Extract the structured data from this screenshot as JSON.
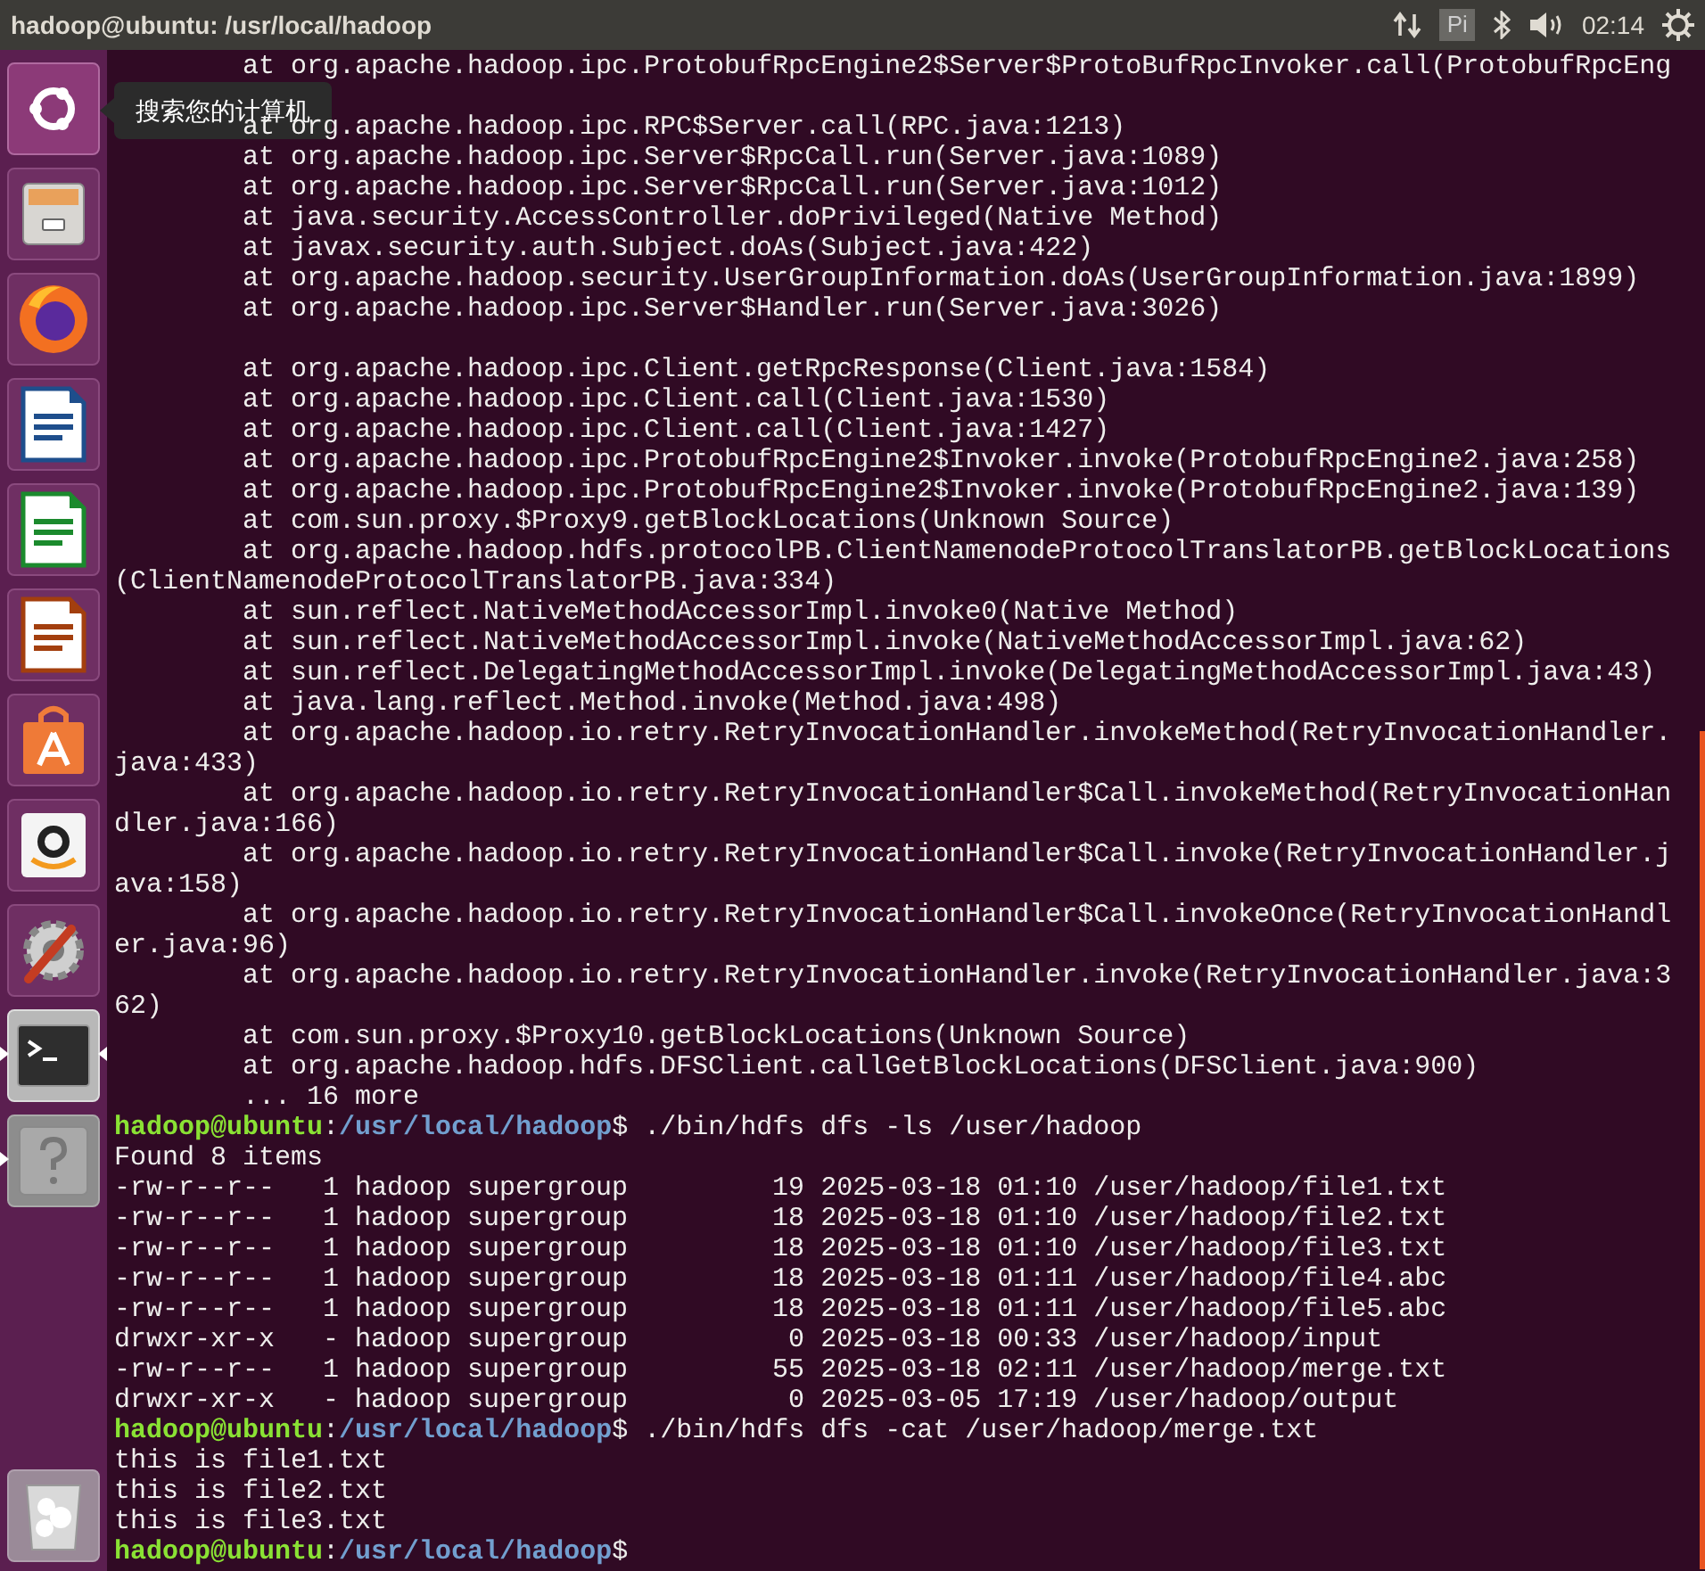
{
  "top_bar": {
    "title": "hadoop@ubuntu: /usr/local/hadoop",
    "input_method": "Pi",
    "clock": "02:14"
  },
  "launcher": {
    "items": [
      {
        "kind": "dash",
        "running": false,
        "focused": false
      },
      {
        "kind": "files",
        "running": false,
        "focused": false
      },
      {
        "kind": "browser",
        "running": false,
        "focused": false
      },
      {
        "kind": "writer",
        "running": false,
        "focused": false
      },
      {
        "kind": "calc",
        "running": false,
        "focused": false
      },
      {
        "kind": "impress",
        "running": false,
        "focused": false
      },
      {
        "kind": "store",
        "running": false,
        "focused": false
      },
      {
        "kind": "amazon",
        "running": false,
        "focused": false
      },
      {
        "kind": "settings",
        "running": false,
        "focused": false
      },
      {
        "kind": "terminal",
        "running": true,
        "focused": true
      },
      {
        "kind": "help",
        "running": true,
        "focused": false
      }
    ],
    "trash": {
      "kind": "trash"
    },
    "tooltip": "搜索您的计算机"
  },
  "terminal": {
    "lines": [
      {
        "kind": "output",
        "text": "        at org.apache.hadoop.ipc.ProtobufRpcEngine2$Server$ProtoBufRpcInvoker.call(ProtobufRpcEng"
      },
      {
        "kind": "blank"
      },
      {
        "kind": "output",
        "text": "        at org.apache.hadoop.ipc.RPC$Server.call(RPC.java:1213)"
      },
      {
        "kind": "output",
        "text": "        at org.apache.hadoop.ipc.Server$RpcCall.run(Server.java:1089)"
      },
      {
        "kind": "output",
        "text": "        at org.apache.hadoop.ipc.Server$RpcCall.run(Server.java:1012)"
      },
      {
        "kind": "output",
        "text": "        at java.security.AccessController.doPrivileged(Native Method)"
      },
      {
        "kind": "output",
        "text": "        at javax.security.auth.Subject.doAs(Subject.java:422)"
      },
      {
        "kind": "output",
        "text": "        at org.apache.hadoop.security.UserGroupInformation.doAs(UserGroupInformation.java:1899)"
      },
      {
        "kind": "output",
        "text": "        at org.apache.hadoop.ipc.Server$Handler.run(Server.java:3026)"
      },
      {
        "kind": "blank"
      },
      {
        "kind": "output",
        "text": "        at org.apache.hadoop.ipc.Client.getRpcResponse(Client.java:1584)"
      },
      {
        "kind": "output",
        "text": "        at org.apache.hadoop.ipc.Client.call(Client.java:1530)"
      },
      {
        "kind": "output",
        "text": "        at org.apache.hadoop.ipc.Client.call(Client.java:1427)"
      },
      {
        "kind": "output",
        "text": "        at org.apache.hadoop.ipc.ProtobufRpcEngine2$Invoker.invoke(ProtobufRpcEngine2.java:258)"
      },
      {
        "kind": "output",
        "text": "        at org.apache.hadoop.ipc.ProtobufRpcEngine2$Invoker.invoke(ProtobufRpcEngine2.java:139)"
      },
      {
        "kind": "output",
        "text": "        at com.sun.proxy.$Proxy9.getBlockLocations(Unknown Source)"
      },
      {
        "kind": "output",
        "text": "        at org.apache.hadoop.hdfs.protocolPB.ClientNamenodeProtocolTranslatorPB.getBlockLocations"
      },
      {
        "kind": "output",
        "text": "(ClientNamenodeProtocolTranslatorPB.java:334)"
      },
      {
        "kind": "output",
        "text": "        at sun.reflect.NativeMethodAccessorImpl.invoke0(Native Method)"
      },
      {
        "kind": "output",
        "text": "        at sun.reflect.NativeMethodAccessorImpl.invoke(NativeMethodAccessorImpl.java:62)"
      },
      {
        "kind": "output",
        "text": "        at sun.reflect.DelegatingMethodAccessorImpl.invoke(DelegatingMethodAccessorImpl.java:43)"
      },
      {
        "kind": "output",
        "text": "        at java.lang.reflect.Method.invoke(Method.java:498)"
      },
      {
        "kind": "output",
        "text": "        at org.apache.hadoop.io.retry.RetryInvocationHandler.invokeMethod(RetryInvocationHandler."
      },
      {
        "kind": "output",
        "text": "java:433)"
      },
      {
        "kind": "output",
        "text": "        at org.apache.hadoop.io.retry.RetryInvocationHandler$Call.invokeMethod(RetryInvocationHan"
      },
      {
        "kind": "output",
        "text": "dler.java:166)"
      },
      {
        "kind": "output",
        "text": "        at org.apache.hadoop.io.retry.RetryInvocationHandler$Call.invoke(RetryInvocationHandler.j"
      },
      {
        "kind": "output",
        "text": "ava:158)"
      },
      {
        "kind": "output",
        "text": "        at org.apache.hadoop.io.retry.RetryInvocationHandler$Call.invokeOnce(RetryInvocationHandl"
      },
      {
        "kind": "output",
        "text": "er.java:96)"
      },
      {
        "kind": "output",
        "text": "        at org.apache.hadoop.io.retry.RetryInvocationHandler.invoke(RetryInvocationHandler.java:3"
      },
      {
        "kind": "output",
        "text": "62)"
      },
      {
        "kind": "output",
        "text": "        at com.sun.proxy.$Proxy10.getBlockLocations(Unknown Source)"
      },
      {
        "kind": "output",
        "text": "        at org.apache.hadoop.hdfs.DFSClient.callGetBlockLocations(DFSClient.java:900)"
      },
      {
        "kind": "output",
        "text": "        ... 16 more"
      },
      {
        "kind": "prompt",
        "user": "hadoop@ubuntu",
        "sep": ":",
        "path": "/usr/local/hadoop",
        "sign": "$",
        "command": " ./bin/hdfs dfs -ls /user/hadoop"
      },
      {
        "kind": "output",
        "text": "Found 8 items"
      },
      {
        "kind": "output",
        "text": "-rw-r--r--   1 hadoop supergroup         19 2025-03-18 01:10 /user/hadoop/file1.txt"
      },
      {
        "kind": "output",
        "text": "-rw-r--r--   1 hadoop supergroup         18 2025-03-18 01:10 /user/hadoop/file2.txt"
      },
      {
        "kind": "output",
        "text": "-rw-r--r--   1 hadoop supergroup         18 2025-03-18 01:10 /user/hadoop/file3.txt"
      },
      {
        "kind": "output",
        "text": "-rw-r--r--   1 hadoop supergroup         18 2025-03-18 01:11 /user/hadoop/file4.abc"
      },
      {
        "kind": "output",
        "text": "-rw-r--r--   1 hadoop supergroup         18 2025-03-18 01:11 /user/hadoop/file5.abc"
      },
      {
        "kind": "output",
        "text": "drwxr-xr-x   - hadoop supergroup          0 2025-03-18 00:33 /user/hadoop/input"
      },
      {
        "kind": "output",
        "text": "-rw-r--r--   1 hadoop supergroup         55 2025-03-18 02:11 /user/hadoop/merge.txt"
      },
      {
        "kind": "output",
        "text": "drwxr-xr-x   - hadoop supergroup          0 2025-03-05 17:19 /user/hadoop/output"
      },
      {
        "kind": "prompt",
        "user": "hadoop@ubuntu",
        "sep": ":",
        "path": "/usr/local/hadoop",
        "sign": "$",
        "command": " ./bin/hdfs dfs -cat /user/hadoop/merge.txt"
      },
      {
        "kind": "output",
        "text": "this is file1.txt"
      },
      {
        "kind": "output",
        "text": "this is file2.txt"
      },
      {
        "kind": "output",
        "text": "this is file3.txt"
      },
      {
        "kind": "prompt",
        "user": "hadoop@ubuntu",
        "sep": ":",
        "path": "/usr/local/hadoop",
        "sign": "$"
      }
    ]
  }
}
